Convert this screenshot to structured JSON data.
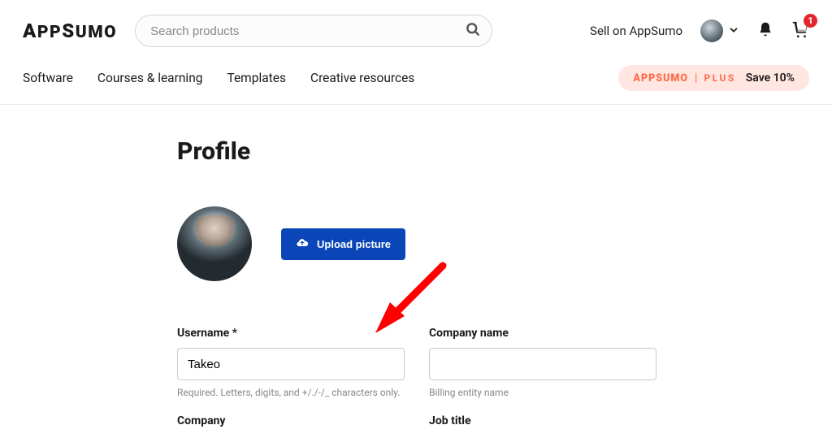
{
  "header": {
    "logo": "APPSUMO",
    "search_placeholder": "Search products",
    "sell_link": "Sell on AppSumo",
    "cart_badge": "1"
  },
  "nav": {
    "items": [
      "Software",
      "Courses & learning",
      "Templates",
      "Creative resources"
    ],
    "plus_logo": "APPSUMO",
    "plus_word": "PLUS",
    "plus_save": "Save 10%"
  },
  "profile": {
    "title": "Profile",
    "upload_label": "Upload picture",
    "fields": {
      "username": {
        "label": "Username *",
        "value": "Takeo",
        "help": "Required. Letters, digits, and +/./-/_ characters only."
      },
      "company_name": {
        "label": "Company name",
        "value": "",
        "help": "Billing entity name"
      },
      "company": {
        "label": "Company",
        "value": ""
      },
      "job_title": {
        "label": "Job title",
        "value": ""
      }
    }
  }
}
